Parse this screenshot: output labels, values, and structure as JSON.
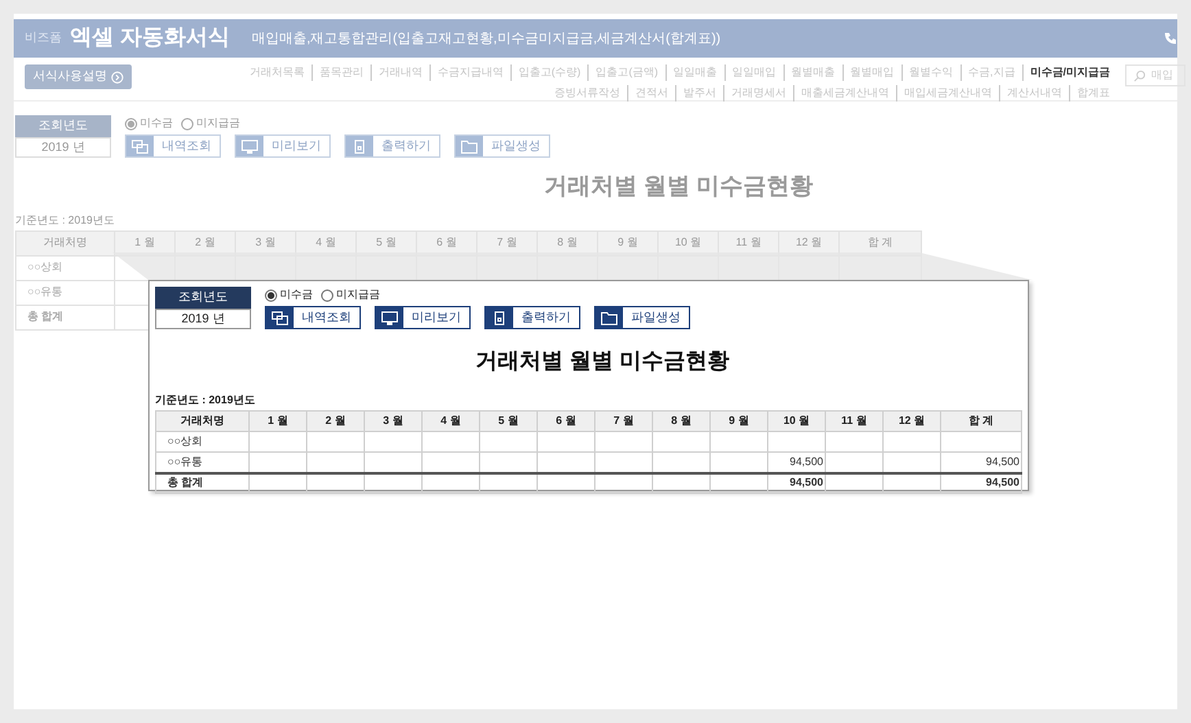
{
  "header": {
    "brand": "비즈폼",
    "title": "엑셀 자동화서식",
    "subtitle": "매입매출,재고통합관리(입출고재고현황,미수금미지급금,세금계산서(합계표))"
  },
  "guide_button": "서식사용설명",
  "nav_rows": [
    [
      {
        "label": "거래처목록",
        "selected": false
      },
      {
        "label": "품목관리",
        "selected": false
      },
      {
        "label": "거래내역",
        "selected": false
      },
      {
        "label": "수금지급내역",
        "selected": false
      },
      {
        "label": "입출고(수량)",
        "selected": false
      },
      {
        "label": "입출고(금액)",
        "selected": false
      },
      {
        "label": "일일매출",
        "selected": false
      },
      {
        "label": "일일매입",
        "selected": false
      },
      {
        "label": "월별매출",
        "selected": false
      },
      {
        "label": "월별매입",
        "selected": false
      },
      {
        "label": "월별수익",
        "selected": false
      },
      {
        "label": "수금,지급",
        "selected": false
      },
      {
        "label": "미수금/미지급금",
        "selected": true
      }
    ],
    [
      {
        "label": "증빙서류작성",
        "selected": false
      },
      {
        "label": "견적서",
        "selected": false
      },
      {
        "label": "발주서",
        "selected": false
      },
      {
        "label": "거래명세서",
        "selected": false
      },
      {
        "label": "매출세금계산내역",
        "selected": false
      },
      {
        "label": "매입세금계산내역",
        "selected": false
      },
      {
        "label": "계산서내역",
        "selected": false
      },
      {
        "label": "합계표",
        "selected": false
      }
    ]
  ],
  "search": {
    "placeholder": "매입"
  },
  "background": {
    "year_label": "조회년도",
    "year_value": "2019 년",
    "radios": [
      {
        "label": "미수금",
        "selected": true
      },
      {
        "label": "미지급금",
        "selected": false
      }
    ],
    "buttons": [
      {
        "label": "내역조회",
        "kind": "list"
      },
      {
        "label": "미리보기",
        "kind": "monitor"
      },
      {
        "label": "출력하기",
        "kind": "print"
      },
      {
        "label": "파일생성",
        "kind": "folder"
      }
    ],
    "title": "거래처별 월별 미수금현황",
    "base_year": "기준년도 : 2019년도",
    "table": {
      "columns": [
        "거래처명",
        "1 월",
        "2 월",
        "3 월",
        "4 월",
        "5 월",
        "6 월",
        "7 월",
        "8 월",
        "9 월",
        "10 월",
        "11 월",
        "12 월",
        "합 계"
      ],
      "rows": [
        {
          "name": "○○상회"
        },
        {
          "name": "○○유통"
        },
        {
          "name": "총 합계",
          "kind": "total"
        }
      ]
    }
  },
  "callout": {
    "year_label": "조회년도",
    "year_value": "2019 년",
    "radios": [
      {
        "label": "미수금",
        "selected": true
      },
      {
        "label": "미지급금",
        "selected": false
      }
    ],
    "buttons": [
      {
        "label": "내역조회",
        "kind": "list"
      },
      {
        "label": "미리보기",
        "kind": "monitor"
      },
      {
        "label": "출력하기",
        "kind": "print"
      },
      {
        "label": "파일생성",
        "kind": "folder"
      }
    ],
    "title": "거래처별 월별 미수금현황",
    "base_year": "기준년도 : 2019년도",
    "table": {
      "columns": [
        "거래처명",
        "1 월",
        "2 월",
        "3 월",
        "4 월",
        "5 월",
        "6 월",
        "7 월",
        "8 월",
        "9 월",
        "10 월",
        "11 월",
        "12 월",
        "합 계"
      ],
      "rows": [
        {
          "name": "○○상회"
        },
        {
          "name": "○○유통",
          "month_10": "94,500",
          "total": "94,500"
        },
        {
          "name": "총 합계",
          "kind": "total",
          "month_10": "94,500",
          "total": "94,500"
        }
      ]
    }
  }
}
